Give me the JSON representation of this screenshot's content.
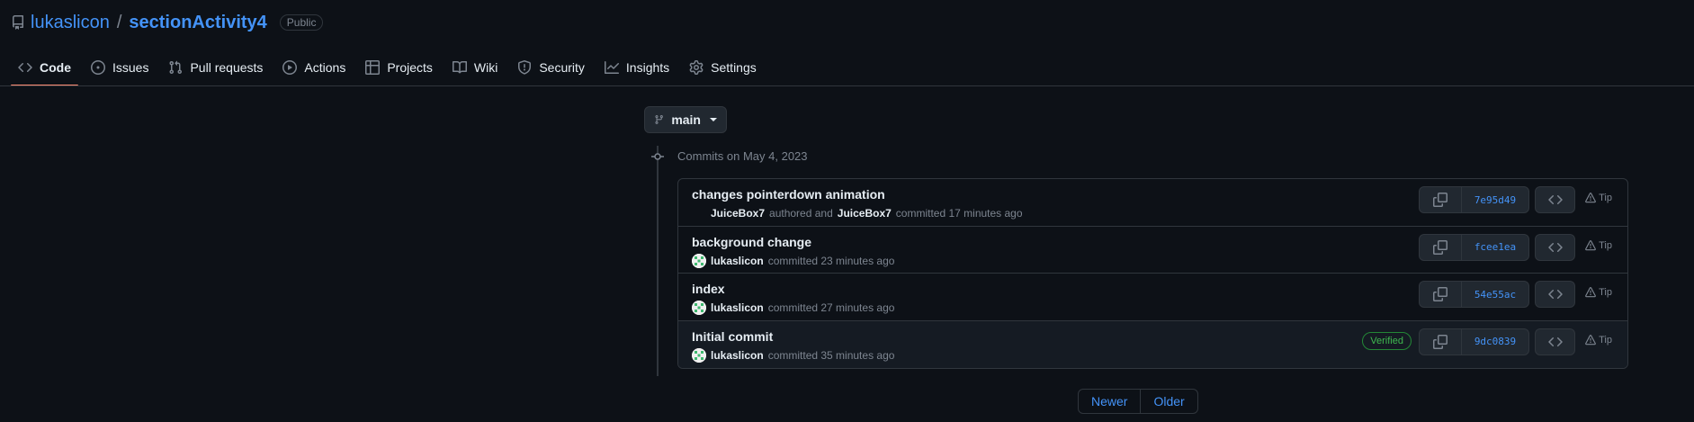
{
  "repo": {
    "owner": "lukaslicon",
    "separator": "/",
    "name": "sectionActivity4",
    "visibility": "Public"
  },
  "tabs": [
    {
      "label": "Code",
      "icon": "code-icon"
    },
    {
      "label": "Issues",
      "icon": "issue-icon"
    },
    {
      "label": "Pull requests",
      "icon": "pull-request-icon"
    },
    {
      "label": "Actions",
      "icon": "play-icon"
    },
    {
      "label": "Projects",
      "icon": "table-icon"
    },
    {
      "label": "Wiki",
      "icon": "book-icon"
    },
    {
      "label": "Security",
      "icon": "shield-icon"
    },
    {
      "label": "Insights",
      "icon": "graph-icon"
    },
    {
      "label": "Settings",
      "icon": "gear-icon"
    }
  ],
  "branch": {
    "label": "main"
  },
  "commits_heading": "Commits on May 4, 2023",
  "commits": [
    {
      "title": "changes pointerdown animation",
      "author": "JuiceBox7",
      "authored_text": "authored and",
      "committer": "JuiceBox7",
      "committed_text": "committed 17 minutes ago",
      "sha": "7e95d49",
      "tip": "Tip"
    },
    {
      "title": "background change",
      "author": "lukaslicon",
      "committed_text": "committed 23 minutes ago",
      "sha": "fcee1ea",
      "tip": "Tip"
    },
    {
      "title": "index",
      "author": "lukaslicon",
      "committed_text": "committed 27 minutes ago",
      "sha": "54e55ac",
      "tip": "Tip"
    },
    {
      "title": "Initial commit",
      "author": "lukaslicon",
      "committed_text": "committed 35 minutes ago",
      "sha": "9dc0839",
      "verified": "Verified",
      "tip": "Tip"
    }
  ],
  "pagination": {
    "newer": "Newer",
    "older": "Older"
  },
  "colors": {
    "background": "#0d1117",
    "link": "#4493f8",
    "active_tab_underline": "#fd8c73",
    "verified": "#3fb950"
  }
}
